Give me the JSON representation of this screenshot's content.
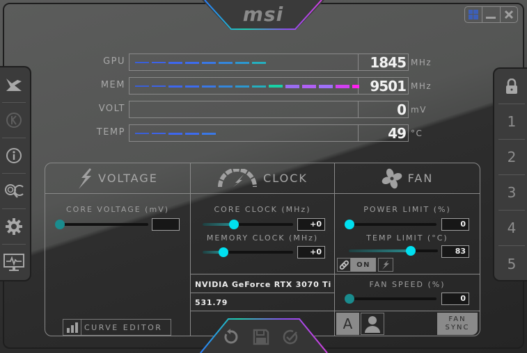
{
  "app": {
    "brand": "msi",
    "window_controls": [
      {
        "name": "windows-icon"
      },
      {
        "name": "minimize-icon"
      },
      {
        "name": "close-icon"
      }
    ]
  },
  "left_sidebar": {
    "items": [
      {
        "name": "kombustor-icon",
        "label": "Kombustor"
      },
      {
        "name": "k-boost-icon",
        "label": "K"
      },
      {
        "name": "info-icon",
        "label": "Info"
      },
      {
        "name": "oc-scanner-icon",
        "label": "OC Scanner"
      },
      {
        "name": "settings-icon",
        "label": "Settings"
      },
      {
        "name": "monitor-icon",
        "label": "Monitor"
      }
    ]
  },
  "profiles": {
    "lock_icon": "lock-icon",
    "items": [
      "1",
      "2",
      "3",
      "4",
      "5"
    ]
  },
  "monitor": {
    "rows": [
      {
        "label": "GPU",
        "value": "1845",
        "unit": "MHz",
        "level": 0.55
      },
      {
        "label": "MEM",
        "value": "9501",
        "unit": "MHz",
        "level": 1.0
      },
      {
        "label": "VOLT",
        "value": "0",
        "unit": "mV",
        "level": 0.0
      },
      {
        "label": "TEMP",
        "value": "49",
        "unit": "°C",
        "level": 0.35
      }
    ],
    "segment_colors": [
      "#3a5fd8",
      "#3d63e8",
      "#3e67ee",
      "#3d6cee",
      "#3a78e6",
      "#3487dc",
      "#2c98d0",
      "#25afbf",
      "#19d2a6",
      "#9a6cf0",
      "#b060f4",
      "#a070f8",
      "#d040f0",
      "#ff20f0"
    ]
  },
  "voltage": {
    "title": "VOLTAGE",
    "core_voltage_label": "CORE VOLTAGE  (mV)",
    "core_voltage_value": "",
    "core_voltage_pos": 0.0,
    "curve_editor_label": "CURVE EDITOR"
  },
  "clock": {
    "title": "CLOCK",
    "core_clock_label": "CORE CLOCK (MHz)",
    "core_clock_value": "+0",
    "core_clock_pos": 0.33,
    "memory_clock_label": "MEMORY CLOCK (MHz)",
    "memory_clock_value": "+0",
    "memory_clock_pos": 0.2,
    "gpu_name": "NVIDIA GeForce RTX 3070 Ti",
    "driver_version": "531.79"
  },
  "fan": {
    "title": "FAN",
    "power_limit_label": "POWER LIMIT (%)",
    "power_limit_value": "0",
    "power_limit_pos": 0.0,
    "temp_limit_label": "TEMP LIMIT (°C)",
    "temp_limit_value": "83",
    "temp_limit_pos": 0.72,
    "link_toggle_label": "ON",
    "fan_speed_label": "FAN SPEED (%)",
    "fan_speed_value": "0",
    "fan_speed_pos": 0.0,
    "auto_label": "A",
    "fan_sync_line1": "FAN",
    "fan_sync_line2": "SYNC"
  },
  "bottom_actions": [
    {
      "name": "reset-icon",
      "label": "Reset"
    },
    {
      "name": "save-icon",
      "label": "Save"
    },
    {
      "name": "apply-icon",
      "label": "Apply"
    }
  ]
}
